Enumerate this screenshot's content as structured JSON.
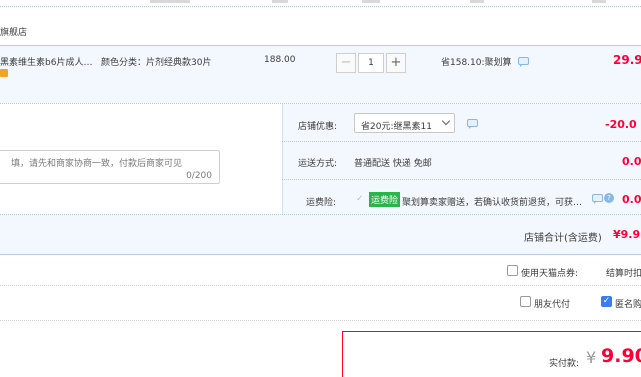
{
  "store": {
    "name_fragment": "旗舰店"
  },
  "item": {
    "title_fragment": "黑素维生素b6片成人…",
    "variant_label": "颜色分类：",
    "variant_value": "片剂经典款30片",
    "unit_price": "188.00",
    "quantity": "1",
    "saving_text": "省158.10:聚划算",
    "subtotal": "29.9",
    "qty_minus": "−",
    "qty_plus": "+"
  },
  "shop_discount": {
    "label": "店铺优惠:",
    "selected_option": "省20元:继黑素11",
    "amount": "-20.0"
  },
  "message": {
    "placeholder": "填，请先和商家协商一致，付款后商家可见",
    "counter": "0/200"
  },
  "shipping": {
    "label": "运送方式:",
    "method": "普通配送 快递 免邮",
    "amount": "0.0"
  },
  "insurance": {
    "label": "运费险:",
    "badge": "运费险",
    "text": "聚划算卖家赠送，若确认收货前退货，可获…",
    "amount": "0.0"
  },
  "store_total": {
    "label": "店铺合计(含运费)",
    "amount": "¥9.9"
  },
  "tmall_points": {
    "label": "使用天猫点券:",
    "note": "结算时扣"
  },
  "friend_pay": {
    "label": "朋友代付"
  },
  "anonymous": {
    "label": "匿名购"
  },
  "payment": {
    "label": "实付款:",
    "currency": "¥",
    "amount": "9.90"
  },
  "colors": {
    "accent_red": "#ff0036",
    "row_blue": "#f3f8fe",
    "checkbox_blue": "#3b7cf0"
  }
}
